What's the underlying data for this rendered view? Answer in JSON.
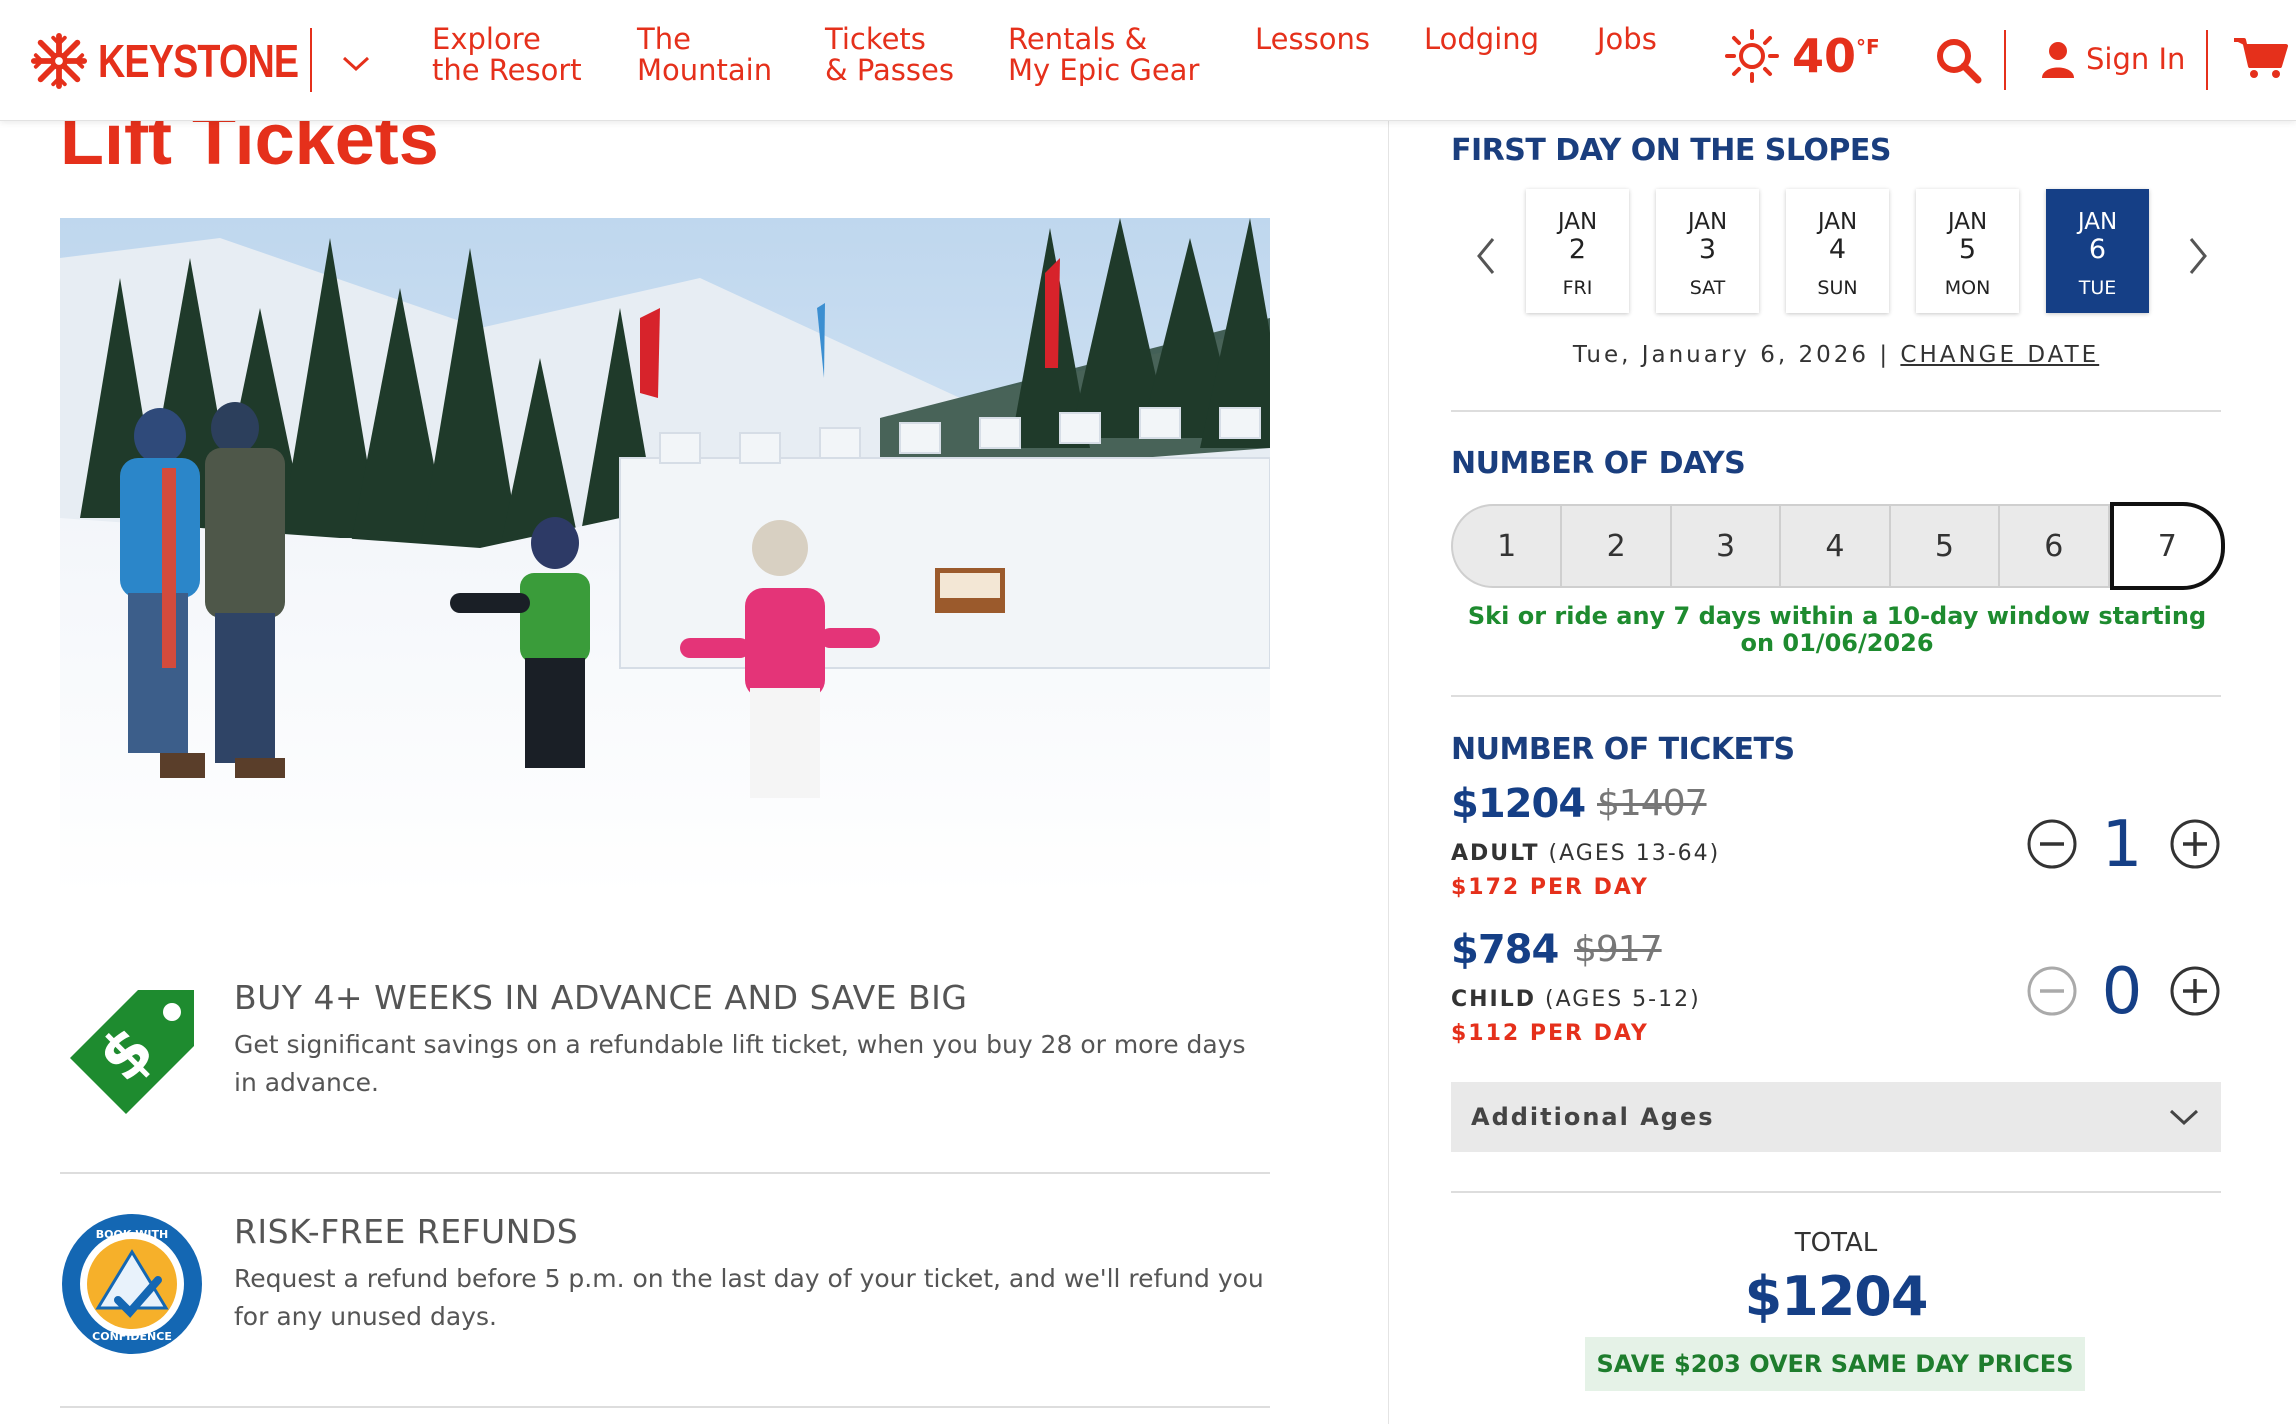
{
  "header": {
    "brand": "KEYSTONE",
    "nav": [
      {
        "line1": "Explore",
        "line2": "the Resort"
      },
      {
        "line1": "The",
        "line2": "Mountain"
      },
      {
        "line1": "Tickets",
        "line2": "& Passes"
      },
      {
        "line1": "Rentals &",
        "line2": "My Epic Gear"
      },
      {
        "line1": "Lessons",
        "line2": ""
      },
      {
        "line1": "Lodging",
        "line2": ""
      },
      {
        "line1": "Jobs",
        "line2": ""
      }
    ],
    "weather_temp": "40",
    "weather_unit": "°F",
    "sign_in": "Sign In",
    "brand_color": "#e5301b"
  },
  "page": {
    "title": "Lift Tickets",
    "features": [
      {
        "icon": "price-tag-icon",
        "title": "BUY 4+ WEEKS IN ADVANCE AND SAVE BIG",
        "desc": "Get significant savings on a refundable lift ticket, when you buy 28 or more days in advance."
      },
      {
        "icon": "book-with-confidence-icon",
        "title": "RISK-FREE REFUNDS",
        "desc": "Request a refund before 5 p.m. on the last day of your ticket, and we'll refund you for any unused days.",
        "badge_top": "BOOK WITH",
        "badge_bottom": "CONFIDENCE"
      }
    ]
  },
  "panel": {
    "first_day_title": "FIRST DAY ON THE SLOPES",
    "dates": [
      {
        "month": "JAN",
        "day": "2",
        "weekday": "FRI",
        "selected": false
      },
      {
        "month": "JAN",
        "day": "3",
        "weekday": "SAT",
        "selected": false
      },
      {
        "month": "JAN",
        "day": "4",
        "weekday": "SUN",
        "selected": false
      },
      {
        "month": "JAN",
        "day": "5",
        "weekday": "MON",
        "selected": false
      },
      {
        "month": "JAN",
        "day": "6",
        "weekday": "TUE",
        "selected": true
      }
    ],
    "selected_date_text": "Tue, January 6, 2026 |",
    "change_date": "CHANGE DATE",
    "days_title": "NUMBER OF DAYS",
    "days": [
      "1",
      "2",
      "3",
      "4",
      "5",
      "6",
      "7"
    ],
    "selected_days": "7",
    "days_note_line1": "Ski or ride any 7 days within a 10-day window starting",
    "days_note_line2": "on 01/06/2026",
    "tickets_title": "NUMBER OF TICKETS",
    "tickets": [
      {
        "price": "$1204",
        "old_price": "$1407",
        "type": "ADULT",
        "ages": "(AGES 13-64)",
        "per_day": "$172 PER DAY",
        "qty": "1"
      },
      {
        "price": "$784",
        "old_price": "$917",
        "type": "CHILD",
        "ages": "(AGES 5-12)",
        "per_day": "$112 PER DAY",
        "qty": "0"
      }
    ],
    "additional_ages": "Additional Ages",
    "total_label": "TOTAL",
    "total_value": "$1204",
    "save_text": "SAVE $203 OVER SAME DAY PRICES",
    "accent_color": "#153f86",
    "savings_color": "#1e8b2f"
  }
}
